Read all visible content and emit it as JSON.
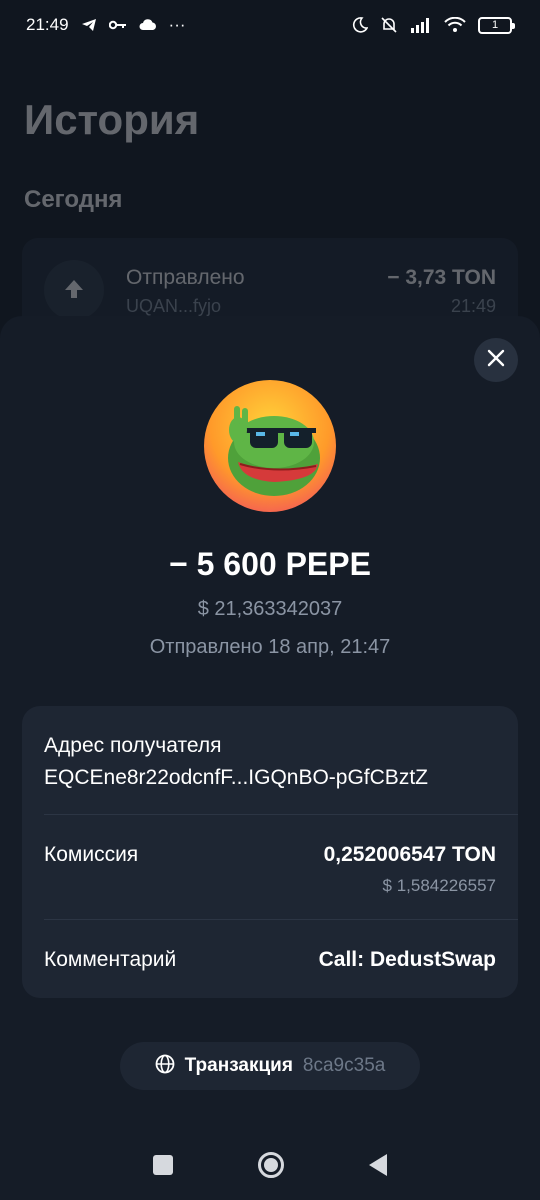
{
  "status_bar": {
    "time": "21:49",
    "more": "···",
    "battery": "1"
  },
  "background": {
    "title": "История",
    "section": "Сегодня",
    "item": {
      "title": "Отправлено",
      "subtitle": "UQAN...fyjo",
      "amount": "− 3,73 TON",
      "time": "21:49"
    }
  },
  "sheet": {
    "amount": "− 5 600 PEPE",
    "fiat": "$ 21,363342037",
    "sent_date": "Отправлено 18 апр, 21:47",
    "recipient_label": "Адрес получателя",
    "recipient_address": "EQCEne8r22odcnfF...IGQnBO-pGfCBztZ",
    "fee_label": "Комиссия",
    "fee_value": "0,252006547 TON",
    "fee_fiat": "$ 1,584226557",
    "comment_label": "Комментарий",
    "comment_value": "Call: DedustSwap",
    "tx_label": "Транзакция",
    "tx_hash": "8ca9c35a"
  },
  "icons": {
    "close": "close-icon",
    "globe": "globe-icon",
    "token": "pepe-token-icon"
  }
}
